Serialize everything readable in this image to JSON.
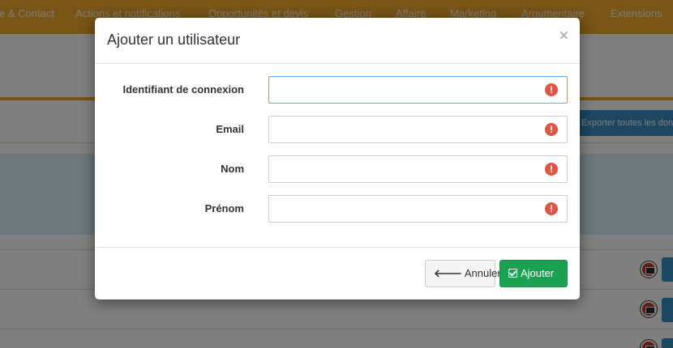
{
  "topnav": {
    "items": [
      "e & Contact",
      "Actions et notifications",
      "Opportunités et devis",
      "Gestion",
      "Affaire",
      "Marketing",
      "Argumentaire",
      "Extensions"
    ]
  },
  "toolbar": {
    "export_label": "Exporter toutes les don"
  },
  "modal": {
    "title": "Ajouter un utilisateur",
    "close_symbol": "×",
    "fields": [
      {
        "label": "Identifiant de connexion",
        "value": "",
        "focused": true
      },
      {
        "label": "Email",
        "value": ""
      },
      {
        "label": "Nom",
        "value": ""
      },
      {
        "label": "Prénom",
        "value": ""
      }
    ],
    "warning_symbol": "!",
    "cancel_label": "Annuler",
    "cancel_icon": "arrow-left-icon",
    "add_label": "Ajouter",
    "add_icon": "check-square-icon"
  },
  "colors": {
    "nav_accent": "#f0a92e",
    "add_button": "#1aa152",
    "warning": "#e15547",
    "info_band": "#d9eef7",
    "link_button": "#3a8cc2"
  }
}
